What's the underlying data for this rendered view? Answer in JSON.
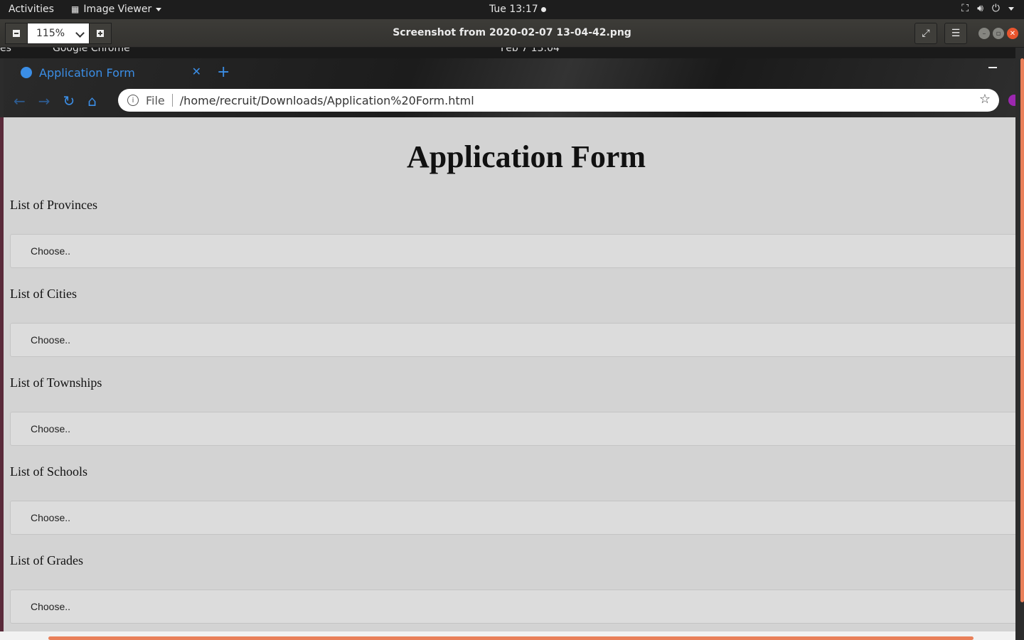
{
  "topbar": {
    "activities": "Activities",
    "app_menu": "Image Viewer",
    "clock": "Tue 13:17"
  },
  "viewer": {
    "zoom": "115%",
    "title": "Screenshot from 2020-02-07 13-04-42.png"
  },
  "captured": {
    "top_left_fragment": "es",
    "app_fragment": "Google Chrome",
    "clock_fragment": "Feb 7  13:04"
  },
  "browser": {
    "tab_title": "Application Form",
    "url_scheme_label": "File",
    "url": "/home/recruit/Downloads/Application%20Form.html"
  },
  "form": {
    "title": "Application Form",
    "fields": [
      {
        "label": "List of Provinces",
        "value": "Choose.."
      },
      {
        "label": "List of Cities",
        "value": "Choose.."
      },
      {
        "label": "List of Townships",
        "value": "Choose.."
      },
      {
        "label": "List of Schools",
        "value": "Choose.."
      },
      {
        "label": "List of Grades",
        "value": "Choose.."
      }
    ]
  },
  "colors": {
    "accent_blue": "#3b8ee6",
    "scroll_orange": "#e9805a",
    "close_button": "#e9552e",
    "page_background": "#d3d3d3"
  },
  "icons": [
    "image-viewer-icon",
    "network-icon",
    "volume-icon",
    "power-icon",
    "fullscreen-icon",
    "menu-icon",
    "globe-icon",
    "back-icon",
    "forward-icon",
    "reload-icon",
    "home-icon",
    "info-icon",
    "star-icon"
  ]
}
